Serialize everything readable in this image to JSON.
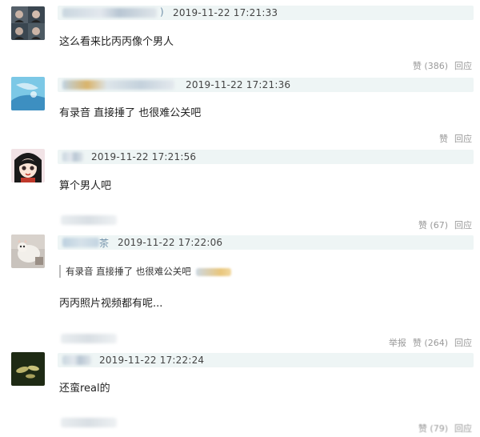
{
  "comments": [
    {
      "time": "2019-11-22 17:21:33",
      "text": "这么看来比丙丙像个男人",
      "like_label": "赞 (386)",
      "reply_label": "回应",
      "name_suffix": ")"
    },
    {
      "time": "2019-11-22 17:21:36",
      "text": "有录音 直接捶了 也很难公关吧",
      "like_label": "赞",
      "reply_label": "回应"
    },
    {
      "time": "2019-11-22 17:21:56",
      "text": "算个男人吧",
      "like_label": "赞 (67)",
      "reply_label": "回应"
    },
    {
      "time": "2019-11-22 17:22:06",
      "name_suffix": "茶",
      "quote": "有录音 直接捶了 也很难公关吧",
      "text": "丙丙照片视频都有呢...",
      "report_label": "举报",
      "like_label": "赞 (264)",
      "reply_label": "回应"
    },
    {
      "time": "2019-11-22 17:22:24",
      "text": "还蛮real的",
      "like_label": "赞 (79)",
      "reply_label": "回应"
    }
  ]
}
